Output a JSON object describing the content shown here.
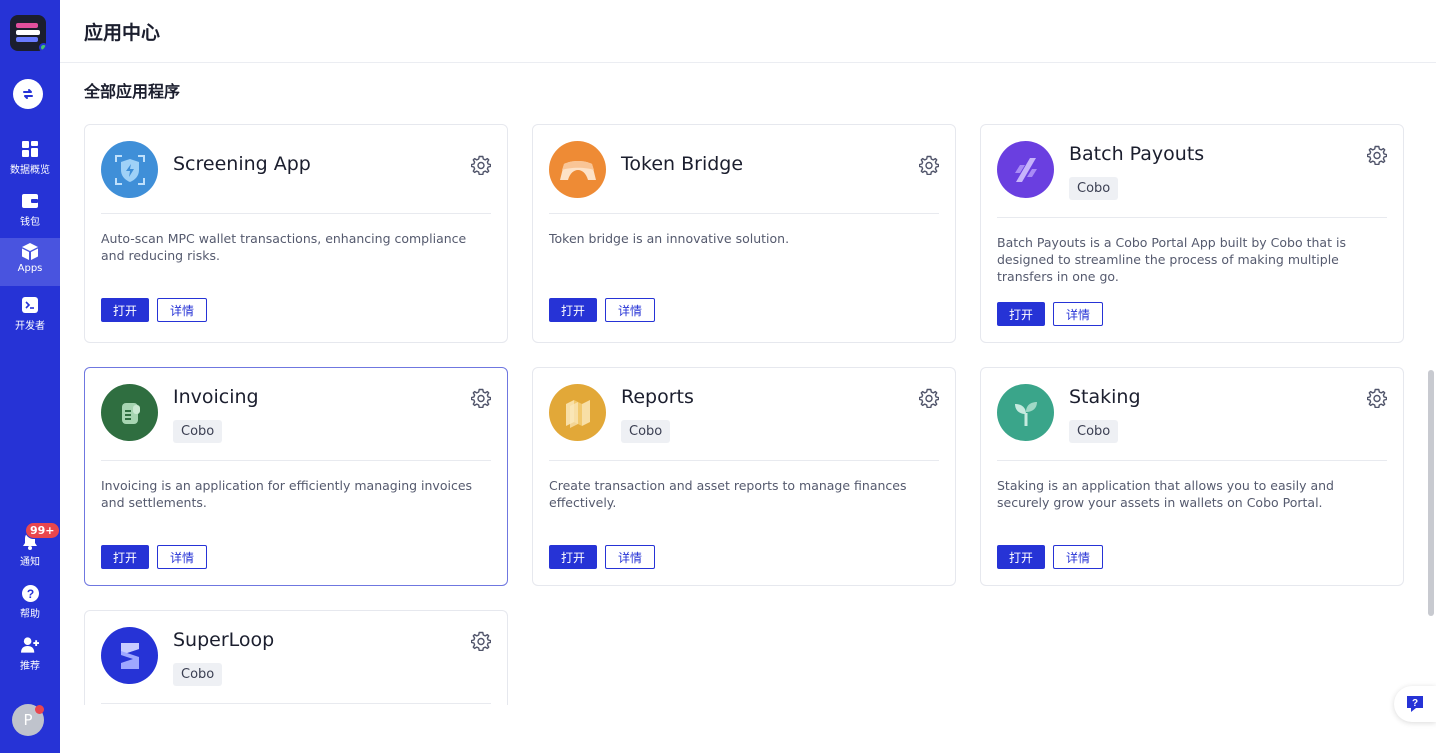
{
  "sidebar": {
    "items": [
      {
        "label": "数据概览",
        "icon": "dashboard-icon"
      },
      {
        "label": "钱包",
        "icon": "wallet-icon"
      },
      {
        "label": "Apps",
        "icon": "apps-cube-icon",
        "active": true
      },
      {
        "label": "开发者",
        "icon": "terminal-icon"
      },
      {
        "label": "通知",
        "icon": "bell-icon"
      },
      {
        "label": "帮助",
        "icon": "help-circle-icon"
      },
      {
        "label": "推荐",
        "icon": "add-user-icon"
      }
    ],
    "notification_badge": "99+",
    "avatar_initial": "P"
  },
  "header": {
    "title": "应用中心"
  },
  "main": {
    "section_title": "全部应用程序",
    "open_label": "打开",
    "detail_label": "详情",
    "apps": [
      {
        "name": "Screening App",
        "tag": "",
        "description": "Auto-scan MPC wallet transactions, enhancing compliance and reducing risks.",
        "icon": "shield-scan-icon",
        "color": "#3f8fd8"
      },
      {
        "name": "Token Bridge",
        "tag": "",
        "description": "Token bridge is an innovative solution.",
        "icon": "bridge-icon",
        "color": "#ee8b35"
      },
      {
        "name": "Batch Payouts",
        "tag": "Cobo",
        "description": "Batch Payouts is a Cobo Portal App built by Cobo that is designed to streamline the process of making multiple transfers in one go.",
        "icon": "batch-payouts-icon",
        "color": "#6a3fe0"
      },
      {
        "name": "Invoicing",
        "tag": "Cobo",
        "description": "Invoicing is an application for efficiently managing invoices and settlements.",
        "icon": "invoice-icon",
        "color": "#2f6e40"
      },
      {
        "name": "Reports",
        "tag": "Cobo",
        "description": "Create transaction and asset reports to manage finances effectively.",
        "icon": "reports-icon",
        "color": "#e2a838"
      },
      {
        "name": "Staking",
        "tag": "Cobo",
        "description": "Staking is an application that allows you to easily and securely grow your assets in wallets on Cobo Portal.",
        "icon": "sprout-icon",
        "color": "#3aa58a"
      },
      {
        "name": "SuperLoop",
        "tag": "Cobo",
        "description": "",
        "icon": "superloop-icon",
        "color": "#2633d6"
      }
    ]
  },
  "colors": {
    "sidebar_bg": "#2633d6",
    "primary": "#2633d6",
    "badge": "#e8464e"
  }
}
